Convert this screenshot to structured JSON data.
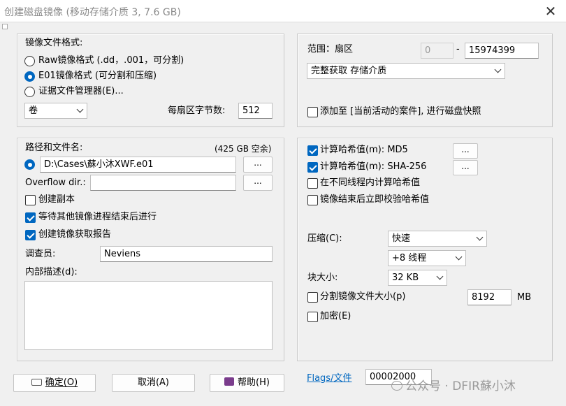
{
  "window": {
    "title": "创建磁盘镜像 (移动存储介质 3, 7.6 GB)",
    "close_glyph": "✕"
  },
  "format": {
    "heading": "镜像文件格式:",
    "options": [
      {
        "label": "Raw镜像格式 (.dd，.001，可分割)",
        "selected": false
      },
      {
        "label": "E01镜像格式 (可分割和压缩)",
        "selected": true
      },
      {
        "label": "证据文件管理器(E)...",
        "selected": false
      }
    ],
    "volume_select": "卷",
    "bytes_per_sector_label": "每扇区字节数:",
    "bytes_per_sector_value": "512"
  },
  "range": {
    "label": "范围：扇区",
    "start": "0",
    "separator": "-",
    "end": "15974399",
    "mode_select": "完整获取 存储介质",
    "add_case_label": "添加至 [当前活动的案件], 进行磁盘快照",
    "add_case_checked": false
  },
  "path": {
    "heading": "路径和文件名:",
    "free_space": "(425 GB 空余)",
    "value": "D:\\Cases\\蘇小沐XWF.e01",
    "browse_label": "...",
    "overflow_label": "Overflow dir.:",
    "overflow_value": "",
    "overflow_browse_label": "...",
    "checkboxes": [
      {
        "label": "创建副本",
        "checked": false
      },
      {
        "label": "等待其他镜像进程结束后进行",
        "checked": true
      },
      {
        "label": "创建镜像获取报告",
        "checked": true
      }
    ],
    "investigator_label": "调查员:",
    "investigator_value": "Neviens",
    "description_label": "内部描述(d):",
    "description_value": ""
  },
  "hash": {
    "rows": [
      {
        "label": "计算哈希值(m): MD5",
        "checked": true,
        "button": "..."
      },
      {
        "label": "计算哈希值(m): SHA-256",
        "checked": true,
        "button": "..."
      },
      {
        "label": "在不同线程内计算哈希值",
        "checked": false
      },
      {
        "label": "镜像结束后立即校验哈希值",
        "checked": false
      }
    ],
    "compression_label": "压缩(C):",
    "compression_value": "快速",
    "threads_value": "+8 线程",
    "block_size_label": "块大小:",
    "block_size_value": "32 KB",
    "split_label": "分割镜像文件大小(p)",
    "split_checked": false,
    "split_value": "8192",
    "split_unit": "MB",
    "encrypt_label": "加密(E)",
    "encrypt_checked": false,
    "flags_label": "Flags/文件",
    "flags_value": "00002000"
  },
  "buttons": {
    "ok": "确定(O)",
    "cancel": "取消(A)",
    "help": "帮助(H)"
  },
  "watermark": "公众号 · DFIR蘇小沐"
}
